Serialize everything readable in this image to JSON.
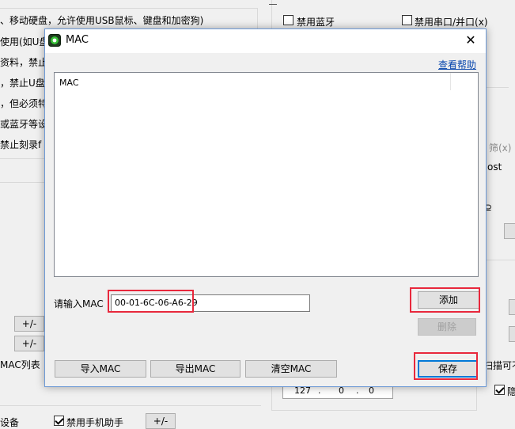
{
  "background": {
    "left_texts": [
      "、移动硬盘，允许使用USB鼠标、键盘和加密狗)",
      "使用(如U盘",
      "资料，禁止/",
      "，禁止U盘",
      "，但必须特",
      "或蓝牙等设",
      "禁止刻录f"
    ],
    "top_right_checkboxes": [
      {
        "label": "禁用蓝牙",
        "checked": false
      },
      {
        "label": "禁用串口/并口(x)",
        "checked": false
      }
    ],
    "right_fragments": [
      "筛(x)",
      "ost",
      "⊇"
    ],
    "plus_minus_label": "+/-",
    "mac_list_label": "MAC列表",
    "ip_parts": [
      "127",
      ".",
      "0",
      ".",
      "0"
    ],
    "right_clip_text": "扫描可不",
    "hide_label": "隐",
    "bottom_left_text": "设备",
    "bottom_checkbox_label": "禁用手机助手"
  },
  "dialog": {
    "title": "MAC",
    "close_glyph": "✕",
    "help_link": "查看帮助",
    "list_column_header": "MAC",
    "input_label": "请输入MAC",
    "input_value": "00-01-6C-06-A6-29",
    "add_button": "添加",
    "delete_button": "删除",
    "import_button": "导入MAC",
    "export_button": "导出MAC",
    "clear_button": "清空MAC",
    "save_button": "保存"
  },
  "colors": {
    "highlight": "#e8283c",
    "link": "#0645ad",
    "focus": "#0078d7"
  }
}
